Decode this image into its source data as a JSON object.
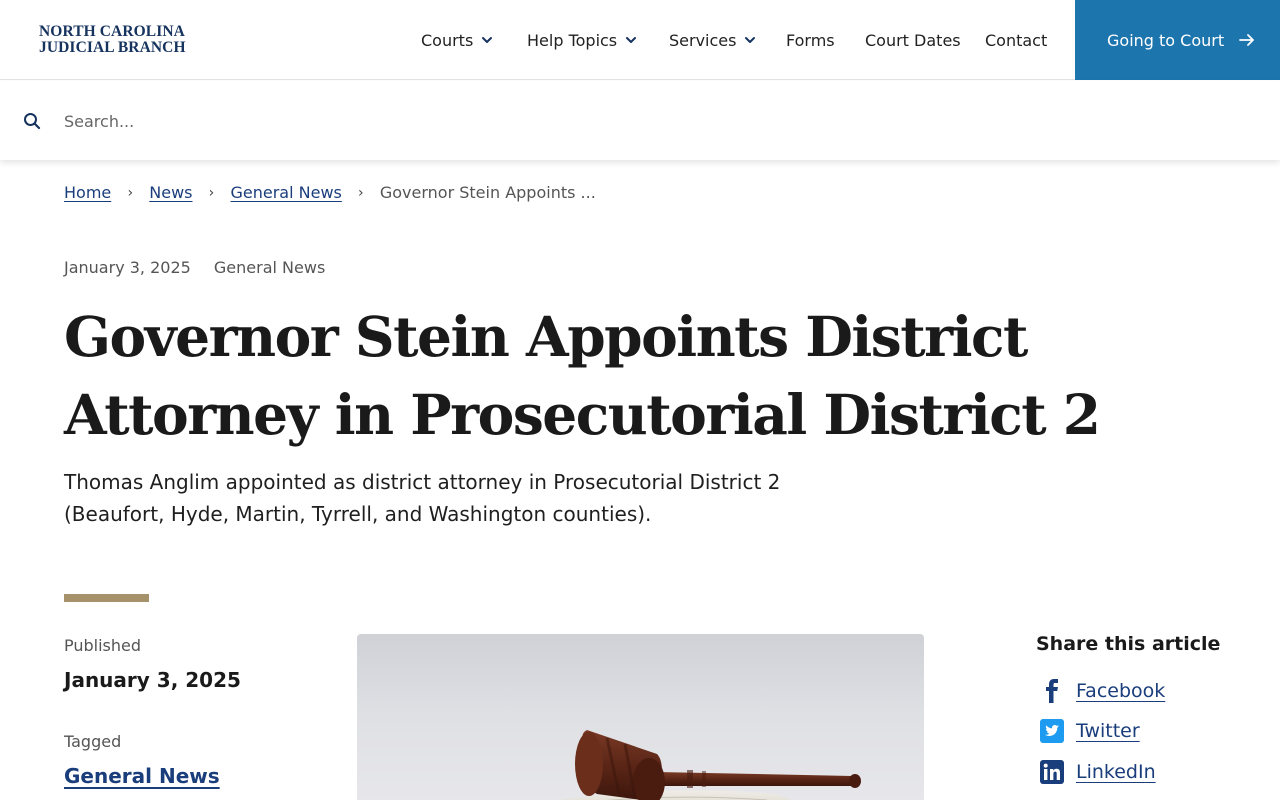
{
  "header": {
    "logo_line1": "NORTH CAROLINA",
    "logo_line2": "JUDICIAL BRANCH",
    "nav": [
      {
        "label": "Courts",
        "has_dropdown": true
      },
      {
        "label": "Help Topics",
        "has_dropdown": true
      },
      {
        "label": "Services",
        "has_dropdown": true
      },
      {
        "label": "Forms",
        "has_dropdown": false
      },
      {
        "label": "Court Dates",
        "has_dropdown": false
      },
      {
        "label": "Contact",
        "has_dropdown": false
      }
    ],
    "cta_label": "Going to Court",
    "cta_icon": "arrow-right-icon"
  },
  "search": {
    "placeholder": "Search...",
    "value": ""
  },
  "breadcrumb": {
    "items": [
      "Home",
      "News",
      "General News"
    ],
    "current": "Governor Stein Appoints ..."
  },
  "article": {
    "date": "January 3, 2025",
    "category": "General News",
    "title": "Governor Stein Appoints District Attorney in Prosecutorial District 2",
    "lede": "Thomas Anglim appointed as district attorney in Prosecutorial District 2 (Beaufort, Hyde, Martin, Tyrrell, and Washington counties)."
  },
  "sidebar": {
    "published_label": "Published",
    "published_value": "January 3, 2025",
    "tagged_label": "Tagged",
    "tag": "General News"
  },
  "share": {
    "title": "Share this article",
    "items": [
      {
        "label": "Facebook",
        "icon": "facebook-icon"
      },
      {
        "label": "Twitter",
        "icon": "twitter-icon"
      },
      {
        "label": "LinkedIn",
        "icon": "linkedin-icon"
      }
    ]
  },
  "colors": {
    "brand_navy": "#16335e",
    "cta_blue": "#1d75ae",
    "link": "#1a3d7c",
    "accent_rule": "#a5916a"
  }
}
